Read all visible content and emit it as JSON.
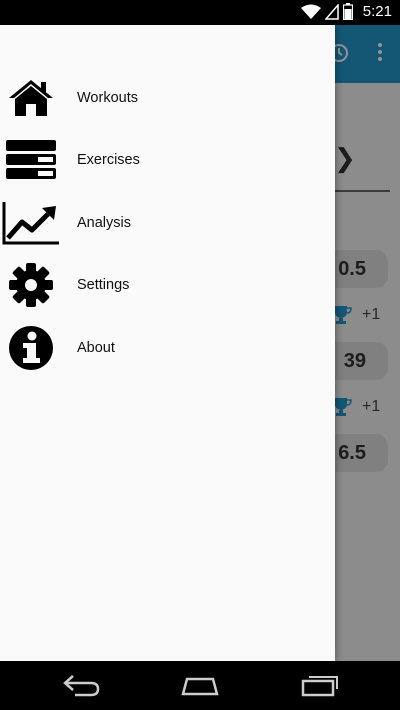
{
  "status_bar": {
    "time": "5:21"
  },
  "background": {
    "values": [
      "0.5",
      "39",
      "6.5"
    ],
    "pr_counts": [
      "+1",
      "+1"
    ]
  },
  "drawer": {
    "items": [
      {
        "label": "Workouts",
        "icon": "home-icon"
      },
      {
        "label": "Exercises",
        "icon": "list-icon"
      },
      {
        "label": "Analysis",
        "icon": "chart-line-icon"
      },
      {
        "label": "Settings",
        "icon": "gear-icon"
      },
      {
        "label": "About",
        "icon": "info-icon"
      }
    ]
  },
  "colors": {
    "toolbar": "#2196c8",
    "drawer_bg": "#fafafa",
    "status_bar": "#000000"
  }
}
